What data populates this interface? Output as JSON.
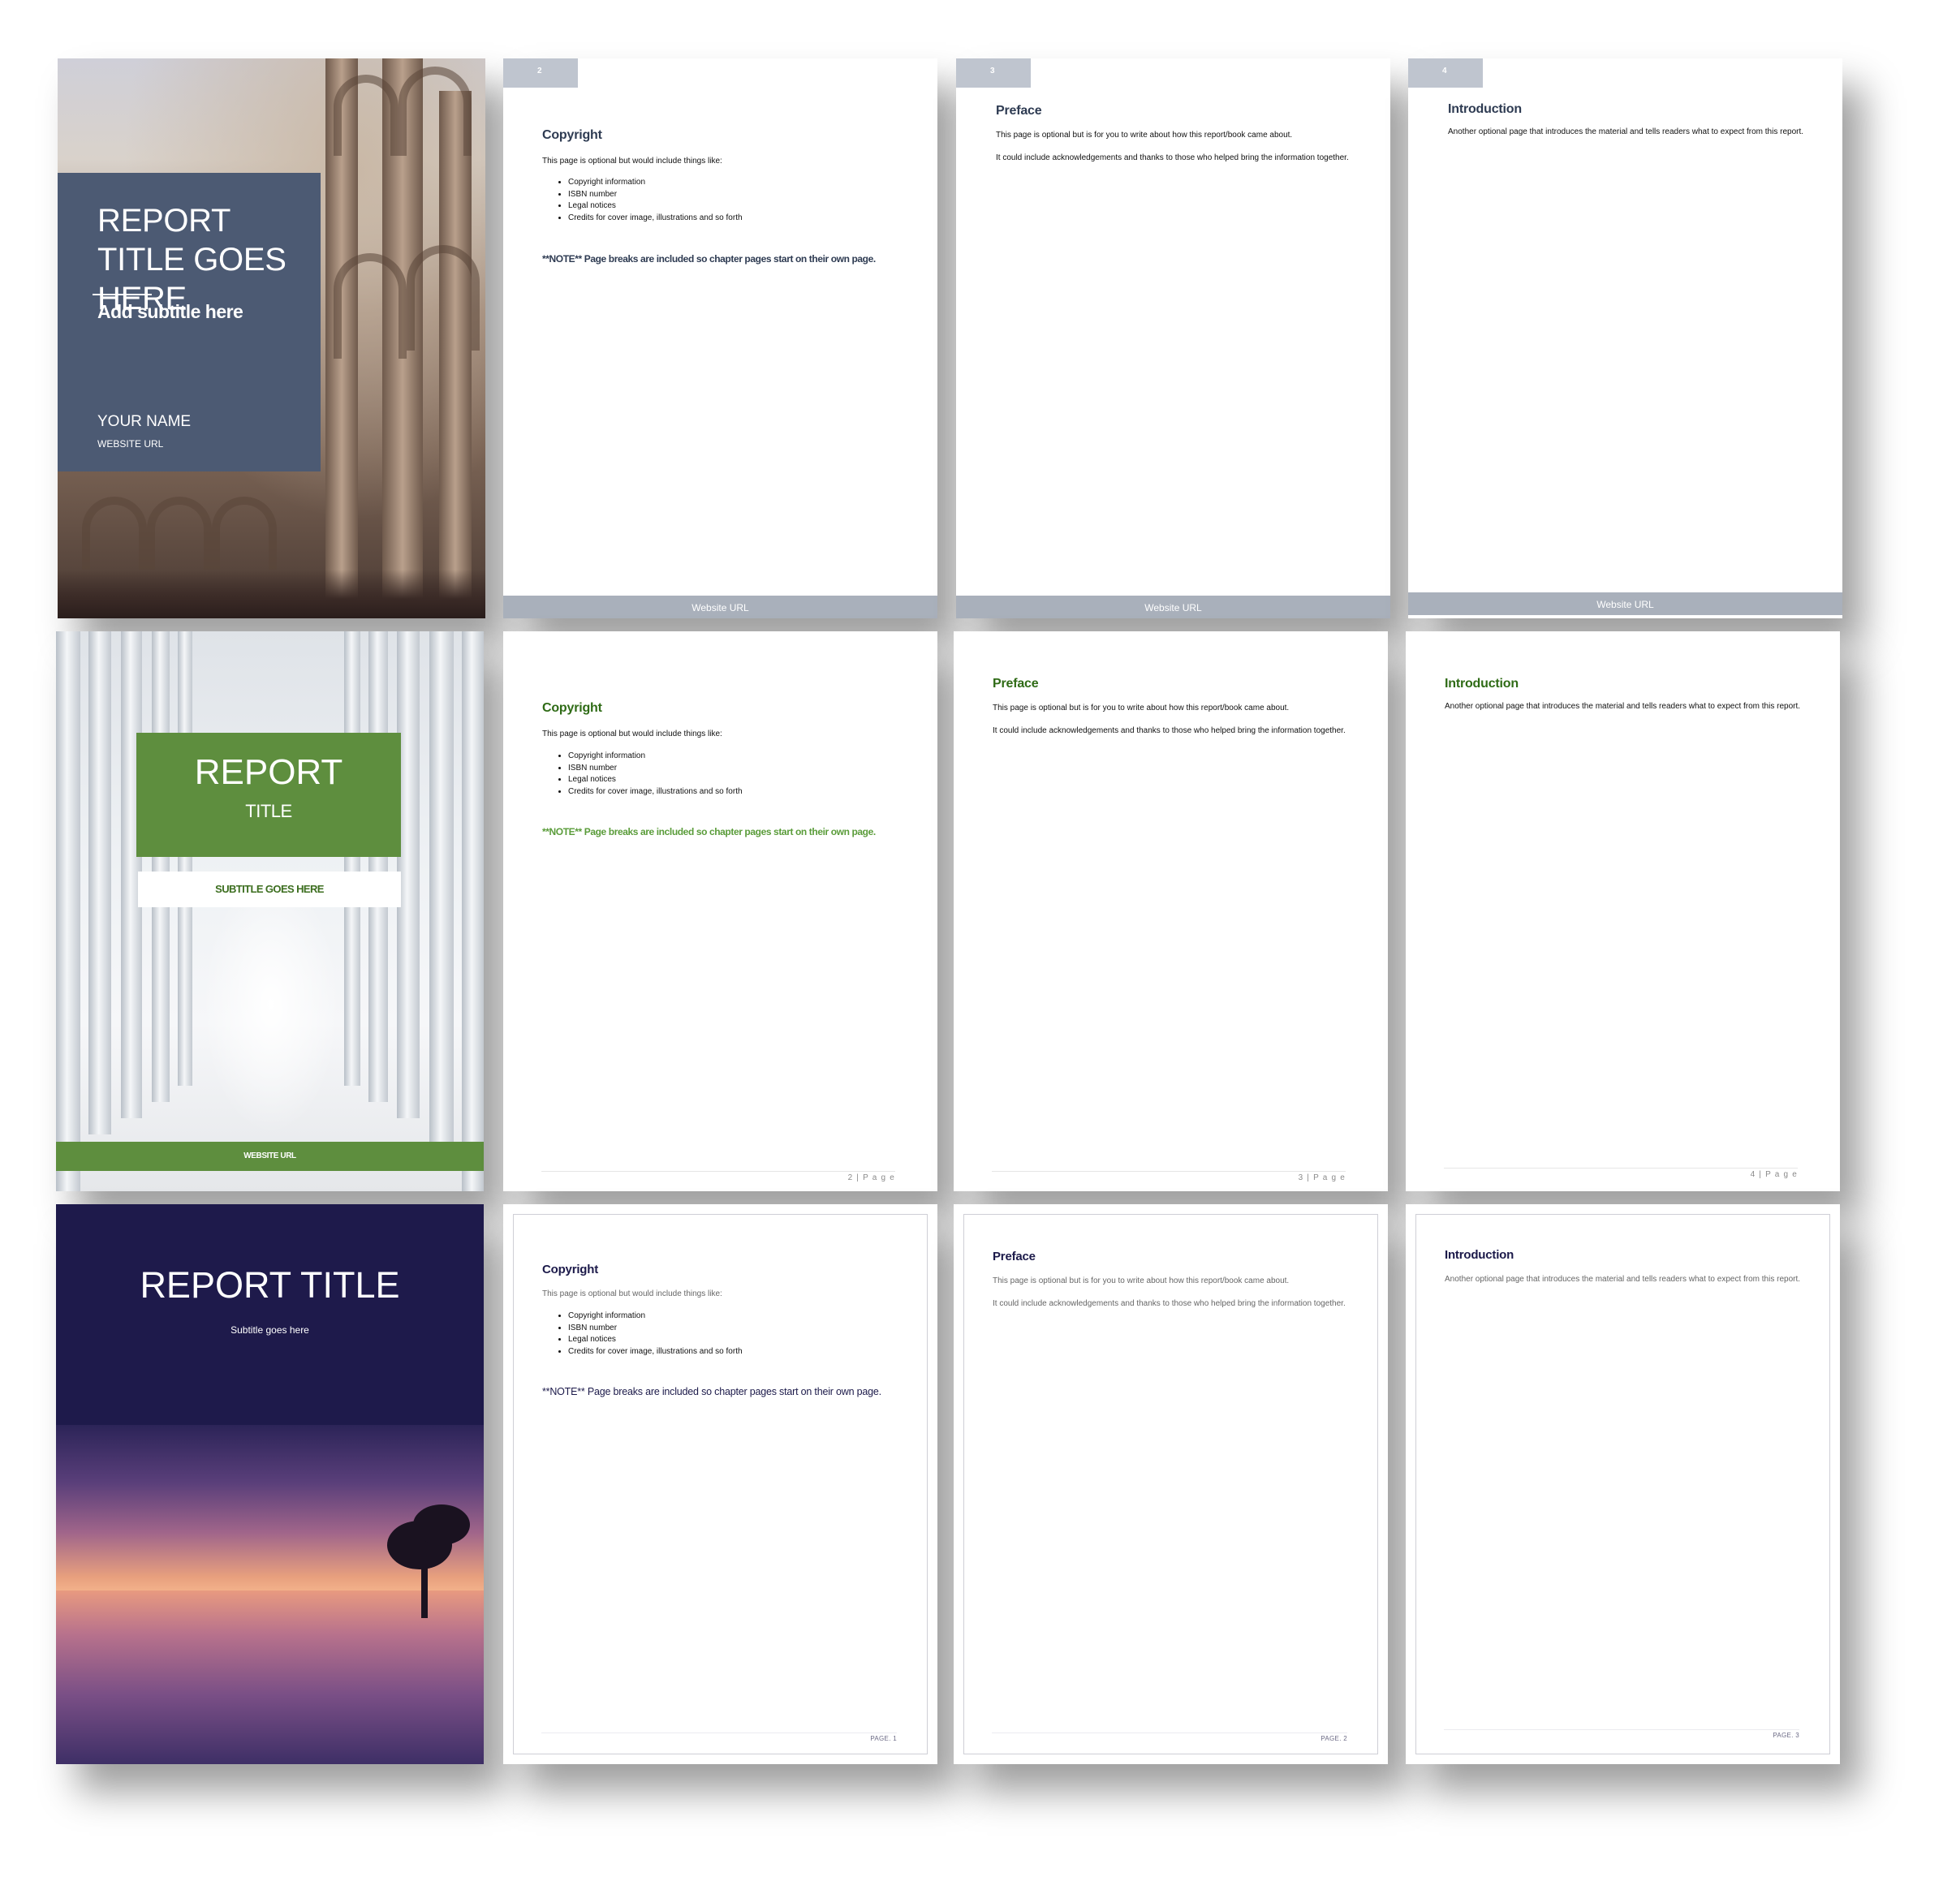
{
  "templates": [
    {
      "cover": {
        "title": "REPORT TITLE GOES HERE",
        "subtitle": "Add subtitle here",
        "author": "YOUR NAME",
        "url": "WEBSITE URL"
      },
      "pages": [
        {
          "tab": "2",
          "heading": "Copyright",
          "intro": "This page is optional but would include things like:",
          "bullets": [
            "Copyright information",
            "ISBN number",
            "Legal notices",
            "Credits for cover image, illustrations and so forth"
          ],
          "note": "**NOTE** Page breaks are included so chapter pages start on their own page.",
          "footer": "Website URL"
        },
        {
          "tab": "3",
          "heading": "Preface",
          "p1": "This page is optional but is for you to write about how this report/book came about.",
          "p2": "It could include acknowledgements and thanks to those who helped bring the information together.",
          "footer": "Website URL"
        },
        {
          "tab": "4",
          "heading": "Introduction",
          "p1": "Another optional page that introduces the material and tells readers what to expect from this report.",
          "footer": "Website URL"
        }
      ]
    },
    {
      "cover": {
        "title_line1": "REPORT",
        "title_line2": "TITLE",
        "subtitle": "SUBTITLE GOES HERE",
        "url": "WEBSITE URL"
      },
      "pages": [
        {
          "heading": "Copyright",
          "intro": "This page is optional but would include things like:",
          "bullets": [
            "Copyright information",
            "ISBN number",
            "Legal notices",
            "Credits for cover image, illustrations and so forth"
          ],
          "note": "**NOTE** Page breaks are included so chapter pages start on their own page.",
          "footer": "2 | P a g e"
        },
        {
          "heading": "Preface",
          "p1": "This page is optional but is for you to write about how this report/book came about.",
          "p2": "It could include acknowledgements and thanks to those who helped bring the information together.",
          "footer": "3 | P a g e"
        },
        {
          "heading": "Introduction",
          "p1": "Another optional page that introduces the material and tells readers what to expect from this report.",
          "footer": "4 | P a g e"
        }
      ]
    },
    {
      "cover": {
        "title": "REPORT TITLE",
        "subtitle": "Subtitle goes here"
      },
      "pages": [
        {
          "heading": "Copyright",
          "intro": "This page is optional but would include things like:",
          "bullets": [
            "Copyright information",
            "ISBN number",
            "Legal notices",
            "Credits for cover image, illustrations and so forth"
          ],
          "note": "**NOTE** Page breaks are included so chapter pages start on their own page.",
          "footer": "PAGE. 1"
        },
        {
          "heading": "Preface",
          "p1": "This page is optional but is for you to write about how this report/book came about.",
          "p2": "It could include acknowledgements and thanks to those who helped bring the information together.",
          "footer": "PAGE. 2"
        },
        {
          "heading": "Introduction",
          "p1": "Another optional page that introduces the material and tells readers what to expect from this report.",
          "footer": "PAGE. 3"
        }
      ]
    }
  ],
  "colors": {
    "slate_panel": "#4c5a73",
    "slate_text": "#2e3b52",
    "green_accent": "#5e8e3e",
    "green_text": "#2f6b16",
    "navy": "#1e1a4a"
  }
}
